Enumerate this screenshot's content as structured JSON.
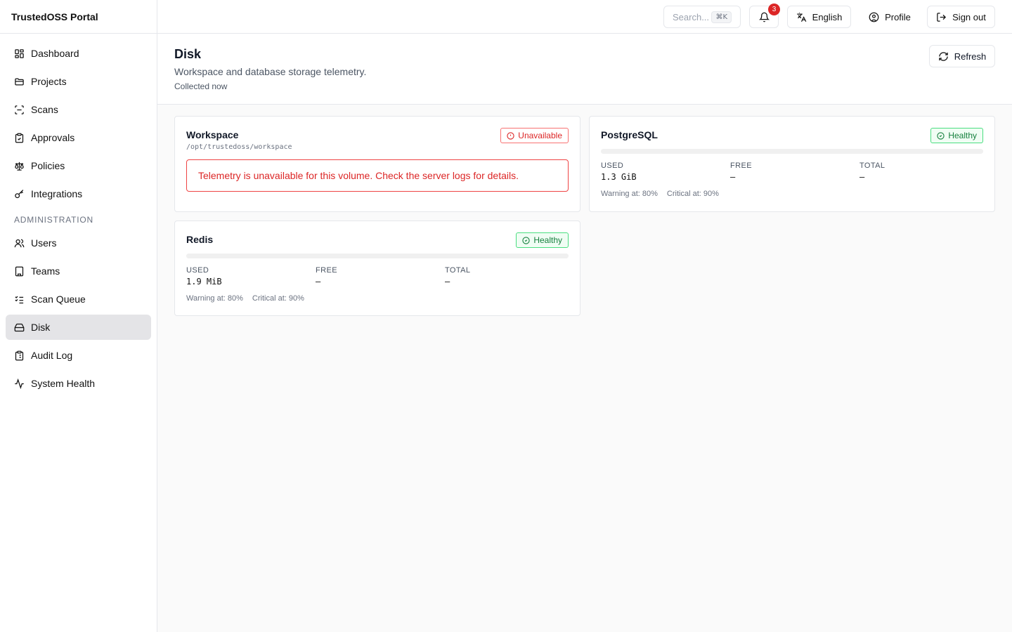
{
  "app": {
    "title": "TrustedOSS Portal"
  },
  "sidebar": {
    "items": [
      {
        "label": "Dashboard",
        "icon": "dashboard-icon"
      },
      {
        "label": "Projects",
        "icon": "folder-icon"
      },
      {
        "label": "Scans",
        "icon": "scan-icon"
      },
      {
        "label": "Approvals",
        "icon": "clipboard-check-icon"
      },
      {
        "label": "Policies",
        "icon": "scale-icon"
      },
      {
        "label": "Integrations",
        "icon": "key-icon"
      }
    ],
    "admin_section_label": "ADMINISTRATION",
    "admin_items": [
      {
        "label": "Users",
        "icon": "users-icon"
      },
      {
        "label": "Teams",
        "icon": "building-icon"
      },
      {
        "label": "Scan Queue",
        "icon": "list-checks-icon"
      },
      {
        "label": "Disk",
        "icon": "hard-drive-icon",
        "active": true
      },
      {
        "label": "Audit Log",
        "icon": "clipboard-list-icon"
      },
      {
        "label": "System Health",
        "icon": "activity-icon"
      }
    ]
  },
  "topbar": {
    "search_placeholder": "Search...",
    "search_shortcut": "⌘K",
    "notifications_count": "3",
    "language_label": "English",
    "profile_label": "Profile",
    "signout_label": "Sign out"
  },
  "page": {
    "title": "Disk",
    "description": "Workspace and database storage telemetry.",
    "collected": "Collected now",
    "refresh_label": "Refresh"
  },
  "volumes": [
    {
      "name": "Workspace",
      "path": "/opt/trustedoss/workspace",
      "status": "Unavailable",
      "error": "Telemetry is unavailable for this volume. Check the server logs for details."
    },
    {
      "name": "PostgreSQL",
      "status": "Healthy",
      "used_label": "USED",
      "used": "1.3 GiB",
      "free_label": "FREE",
      "free": "—",
      "total_label": "TOTAL",
      "total": "—",
      "usage_fraction": 0,
      "warning": "Warning at: 80%",
      "critical": "Critical at: 90%"
    },
    {
      "name": "Redis",
      "status": "Healthy",
      "used_label": "USED",
      "used": "1.9 MiB",
      "free_label": "FREE",
      "free": "—",
      "total_label": "TOTAL",
      "total": "—",
      "usage_fraction": 0,
      "warning": "Warning at: 80%",
      "critical": "Critical at: 90%"
    }
  ],
  "colors": {
    "accent_danger": "#dc2626",
    "accent_success": "#15803d",
    "active_nav_bg": "#e4e4e7"
  }
}
